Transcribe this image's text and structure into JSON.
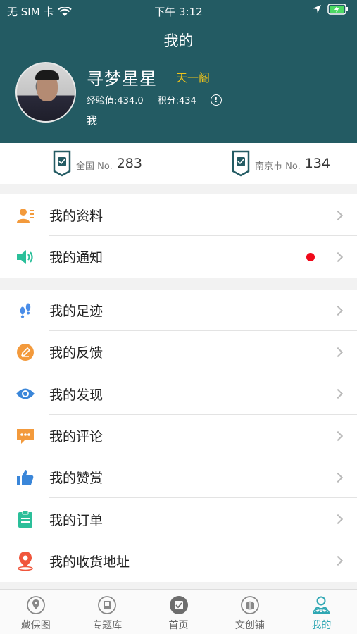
{
  "status_bar": {
    "carrier": "无 SIM 卡",
    "time": "下午 3:12"
  },
  "nav": {
    "title": "我的"
  },
  "profile": {
    "username": "寻梦星星",
    "level": "天一阁",
    "experience": "经验值:434.0",
    "points": "积分:434",
    "bio": "我"
  },
  "ranks": [
    {
      "label": "全国 No.",
      "number": "283"
    },
    {
      "label": "南京市 No.",
      "number": "134"
    }
  ],
  "menu_group1": [
    {
      "label": "我的资料",
      "icon": "profile-card-icon"
    },
    {
      "label": "我的通知",
      "icon": "speaker-icon",
      "unread": true
    }
  ],
  "menu_group2": [
    {
      "label": "我的足迹",
      "icon": "footprints-icon"
    },
    {
      "label": "我的反馈",
      "icon": "pencil-icon"
    },
    {
      "label": "我的发现",
      "icon": "eye-icon"
    },
    {
      "label": "我的评论",
      "icon": "comment-icon"
    },
    {
      "label": "我的赞赏",
      "icon": "thumbs-up-icon"
    },
    {
      "label": "我的订单",
      "icon": "clipboard-icon"
    },
    {
      "label": "我的收货地址",
      "icon": "location-pin-icon"
    }
  ],
  "tabs": [
    {
      "label": "藏保图",
      "icon": "map-pin-icon"
    },
    {
      "label": "专题库",
      "icon": "library-icon"
    },
    {
      "label": "首页",
      "icon": "home-book-icon"
    },
    {
      "label": "文创铺",
      "icon": "shop-icon"
    },
    {
      "label": "我的",
      "icon": "user-icon",
      "active": true
    }
  ],
  "colors": {
    "header_bg": "#235b63",
    "accent": "#2fa7b3",
    "level": "#f0c419",
    "badge": "#f0091a"
  }
}
